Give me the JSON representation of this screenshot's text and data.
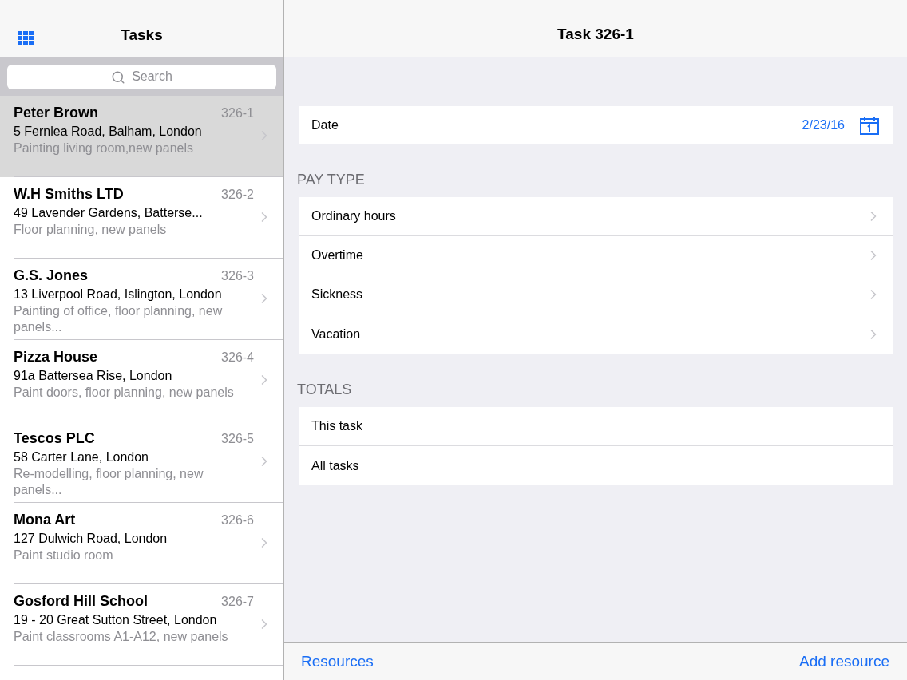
{
  "sidebar": {
    "title": "Tasks",
    "search": {
      "placeholder": "Search"
    },
    "tasks": [
      {
        "name": "Peter Brown",
        "number": "326-1",
        "address": "5 Fernlea Road, Balham, London",
        "description": "Painting living room,new panels",
        "selected": true
      },
      {
        "name": "W.H Smiths LTD",
        "number": "326-2",
        "address": "49 Lavender Gardens, Batterse...",
        "description": "Floor planning, new panels",
        "selected": false
      },
      {
        "name": "G.S. Jones",
        "number": "326-3",
        "address": "13 Liverpool Road, Islington, London",
        "description": "Painting of office, floor planning, new panels...",
        "selected": false
      },
      {
        "name": "Pizza House",
        "number": "326-4",
        "address": "91a Battersea Rise, London",
        "description": "Paint doors, floor planning, new panels",
        "selected": false
      },
      {
        "name": "Tescos PLC",
        "number": "326-5",
        "address": "58 Carter Lane, London",
        "description": "Re-modelling, floor planning, new panels...",
        "selected": false
      },
      {
        "name": "Mona Art",
        "number": "326-6",
        "address": "127 Dulwich Road, London",
        "description": "Paint studio room",
        "selected": false
      },
      {
        "name": "Gosford Hill School",
        "number": "326-7",
        "address": "19 - 20 Great Sutton Street, London",
        "description": "Paint classrooms A1-A12, new panels",
        "selected": false
      }
    ]
  },
  "detail": {
    "title": "Task 326-1",
    "date": {
      "label": "Date",
      "value": "2/23/16"
    },
    "sections": [
      {
        "header": "PAY TYPE",
        "rows": [
          {
            "label": "Ordinary hours",
            "kind": "link"
          },
          {
            "label": "Overtime",
            "kind": "link"
          },
          {
            "label": "Sickness",
            "kind": "link"
          },
          {
            "label": "Vacation",
            "kind": "link"
          }
        ]
      },
      {
        "header": "TOTALS",
        "rows": [
          {
            "label": "This task",
            "kind": "plain"
          },
          {
            "label": "All tasks",
            "kind": "plain"
          }
        ]
      }
    ]
  },
  "toolbar": {
    "left": "Resources",
    "right": "Add resource"
  }
}
